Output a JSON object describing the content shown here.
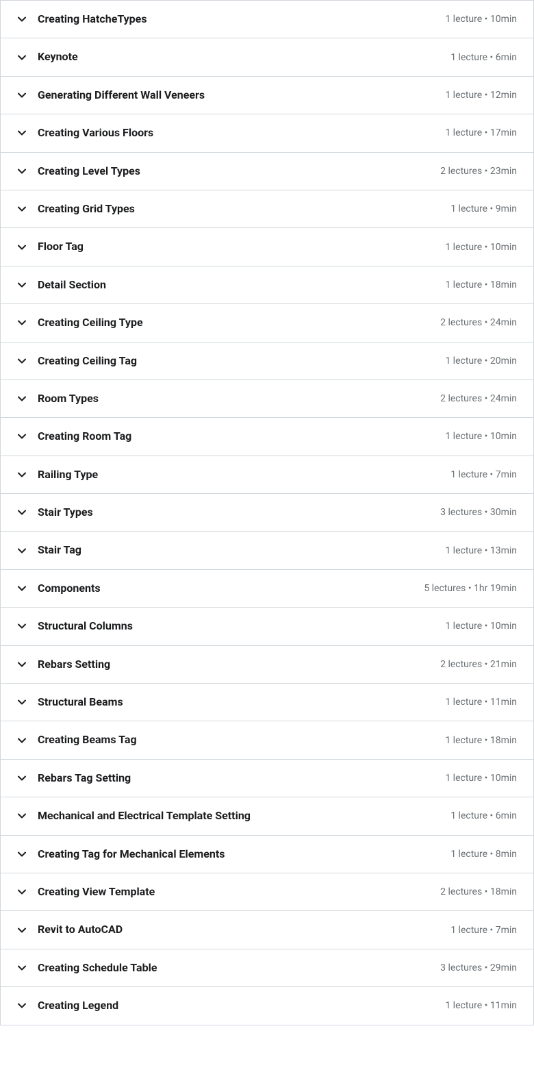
{
  "sections": [
    {
      "title": "Creating HatcheTypes",
      "meta": "1 lecture • 10min"
    },
    {
      "title": "Keynote",
      "meta": "1 lecture • 6min"
    },
    {
      "title": "Generating Different Wall Veneers",
      "meta": "1 lecture • 12min"
    },
    {
      "title": "Creating Various Floors",
      "meta": "1 lecture • 17min"
    },
    {
      "title": "Creating Level Types",
      "meta": "2 lectures • 23min"
    },
    {
      "title": "Creating Grid Types",
      "meta": "1 lecture • 9min"
    },
    {
      "title": "Floor Tag",
      "meta": "1 lecture • 10min"
    },
    {
      "title": "Detail Section",
      "meta": "1 lecture • 18min"
    },
    {
      "title": "Creating Ceiling Type",
      "meta": "2 lectures • 24min"
    },
    {
      "title": "Creating Ceiling Tag",
      "meta": "1 lecture • 20min"
    },
    {
      "title": "Room Types",
      "meta": "2 lectures • 24min"
    },
    {
      "title": "Creating Room Tag",
      "meta": "1 lecture • 10min"
    },
    {
      "title": "Railing Type",
      "meta": "1 lecture • 7min"
    },
    {
      "title": "Stair Types",
      "meta": "3 lectures • 30min"
    },
    {
      "title": "Stair Tag",
      "meta": "1 lecture • 13min"
    },
    {
      "title": "Components",
      "meta": "5 lectures • 1hr 19min"
    },
    {
      "title": "Structural Columns",
      "meta": "1 lecture • 10min"
    },
    {
      "title": "Rebars Setting",
      "meta": "2 lectures • 21min"
    },
    {
      "title": "Structural Beams",
      "meta": "1 lecture • 11min"
    },
    {
      "title": "Creating Beams Tag",
      "meta": "1 lecture • 18min"
    },
    {
      "title": "Rebars Tag Setting",
      "meta": "1 lecture • 10min"
    },
    {
      "title": "Mechanical and Electrical Template Setting",
      "meta": "1 lecture • 6min"
    },
    {
      "title": "Creating Tag for Mechanical Elements",
      "meta": "1 lecture • 8min"
    },
    {
      "title": "Creating View Template",
      "meta": "2 lectures • 18min"
    },
    {
      "title": "Revit to AutoCAD",
      "meta": "1 lecture • 7min"
    },
    {
      "title": "Creating Schedule Table",
      "meta": "3 lectures • 29min"
    },
    {
      "title": "Creating Legend",
      "meta": "1 lecture • 11min"
    }
  ]
}
